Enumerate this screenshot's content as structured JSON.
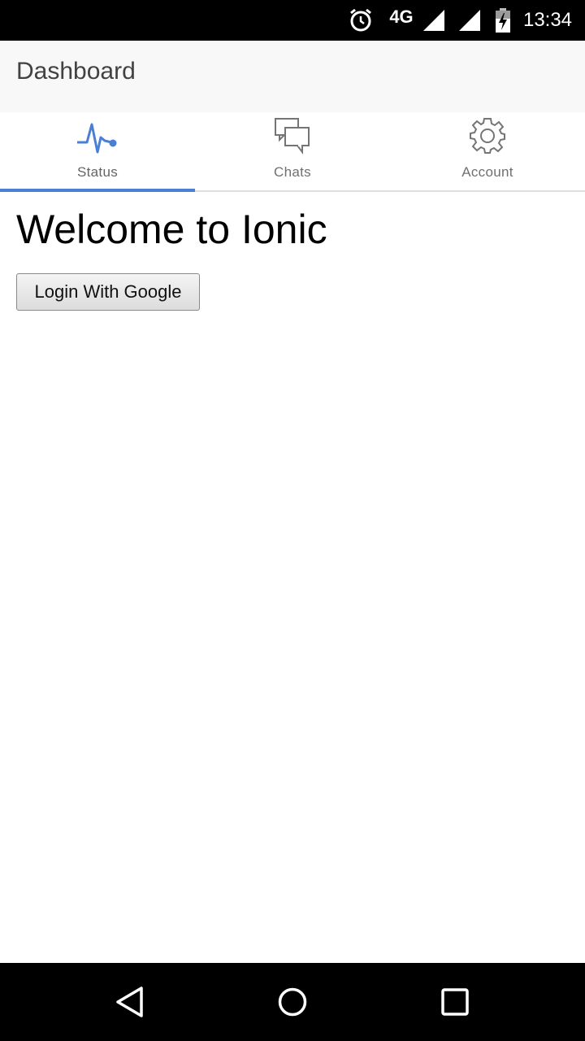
{
  "status_bar": {
    "network": "4G",
    "time": "13:34",
    "icons": [
      "alarm-icon",
      "signal-icon",
      "signal-icon",
      "battery-charging-icon"
    ]
  },
  "header": {
    "title": "Dashboard"
  },
  "tabs": [
    {
      "label": "Status",
      "icon": "pulse-icon",
      "active": true
    },
    {
      "label": "Chats",
      "icon": "chat-bubbles-icon",
      "active": false
    },
    {
      "label": "Account",
      "icon": "gear-icon",
      "active": false
    }
  ],
  "main": {
    "heading": "Welcome to Ionic",
    "login_button": "Login With Google"
  },
  "nav_bar": {
    "icons": [
      "back-icon",
      "home-icon",
      "recents-icon"
    ]
  },
  "colors": {
    "accent": "#4a7fd6",
    "toolbar_bg": "#f8f8f8",
    "status_bar_bg": "#000000"
  }
}
